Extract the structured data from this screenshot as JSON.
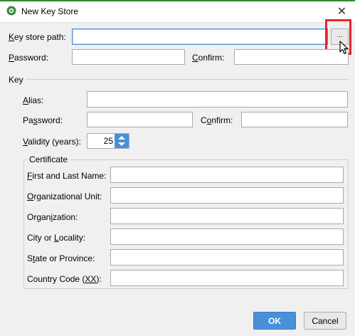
{
  "window": {
    "title": "New Key Store",
    "close_glyph": "✕"
  },
  "keystore": {
    "path_label_u": "K",
    "path_label_rest": "ey store path:",
    "path_value": "",
    "browse_label": "...",
    "password_label_u": "P",
    "password_label_rest": "assword:",
    "password_value": "",
    "confirm_label_u": "C",
    "confirm_label_rest": "onfirm:",
    "confirm_value": ""
  },
  "key": {
    "section_label": "Key",
    "alias_label_u": "A",
    "alias_label_rest": "lias:",
    "alias_value": "",
    "password_label_pre": "Pa",
    "password_label_u": "s",
    "password_label_rest": "sword:",
    "password_value": "",
    "confirm_label_pre": "C",
    "confirm_label_u": "o",
    "confirm_label_rest": "nfirm:",
    "confirm_value": "",
    "validity_label_u": "V",
    "validity_label_rest": "alidity (years):",
    "validity_value": "25"
  },
  "certificate": {
    "group_label": "Certificate",
    "fields": [
      {
        "label_u": "F",
        "label_rest": "irst and Last Name:",
        "value": ""
      },
      {
        "label_u": "O",
        "label_rest": "rganizational Unit:",
        "value": ""
      },
      {
        "label_pre": "Organ",
        "label_u": "i",
        "label_rest": "zation:",
        "value": ""
      },
      {
        "label_pre": "City or ",
        "label_u": "L",
        "label_rest": "ocality:",
        "value": ""
      },
      {
        "label_pre": "S",
        "label_u": "t",
        "label_rest": "ate or Province:",
        "value": ""
      },
      {
        "label_pre": "Country Code (",
        "label_u": "XX",
        "label_rest": "):",
        "value": ""
      }
    ]
  },
  "buttons": {
    "ok": "OK",
    "cancel": "Cancel"
  },
  "colors": {
    "accent": "#4a90d9",
    "highlight": "#e3262f",
    "title_strip": "#2f8a2f"
  },
  "icons": {
    "app": "android-studio-icon",
    "close": "close-icon",
    "spin": "spinner-arrows-icon",
    "cursor": "mouse-pointer-icon"
  }
}
